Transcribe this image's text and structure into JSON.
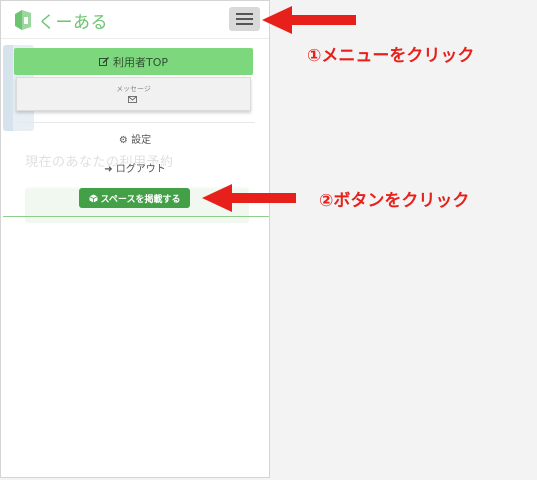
{
  "app": {
    "brand": "くーある"
  },
  "menu": {
    "user_top_label": "利用者TOP",
    "message_label": "メッセージ",
    "settings_label": "設定",
    "logout_label": "ログアウト",
    "post_space_label": "スペースを掲載する"
  },
  "background": {
    "heading": "現在のあなたの利用予約"
  },
  "annotations": {
    "step1": "①メニューをクリック",
    "step2": "②ボタンをクリック",
    "color": "#e8201b"
  },
  "colors": {
    "brand_green": "#6bc46f",
    "menu_button_green": "#7dd87d",
    "post_button_green": "#43a047"
  },
  "icons": {
    "user_top": "edit-icon",
    "message": "envelope-icon",
    "settings": "gear-icon",
    "logout": "sign-out-icon",
    "post_space": "cube-icon",
    "menu": "hamburger-icon"
  }
}
